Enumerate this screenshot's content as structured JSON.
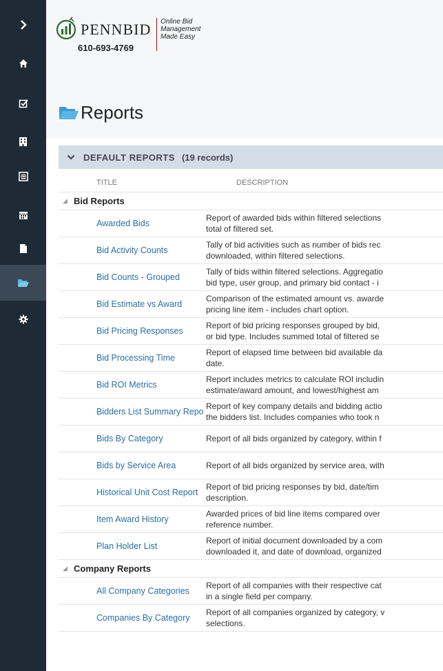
{
  "sidebar": {
    "items": [
      {
        "icon": "chevron-right-icon"
      },
      {
        "icon": "home-icon"
      },
      {
        "icon": "checkbox-icon"
      },
      {
        "icon": "building-icon"
      },
      {
        "icon": "list-icon"
      },
      {
        "icon": "calendar-icon"
      },
      {
        "icon": "document-icon"
      },
      {
        "icon": "folder-open-icon",
        "active": true
      },
      {
        "icon": "gear-icon"
      }
    ],
    "bg_color": "#1e2a35",
    "active_color": "#3b4956"
  },
  "brand": {
    "name": "PENNBID",
    "phone": "610-693-4769",
    "tagline": "Online Bid\nManagement\nMade Easy"
  },
  "page": {
    "title": "Reports"
  },
  "section": {
    "title": "DEFAULT REPORTS",
    "count": "(19 records)"
  },
  "columns": {
    "title": "TITLE",
    "description": "DESCRIPTION"
  },
  "groups": [
    {
      "label": "Bid Reports",
      "rows": [
        {
          "title": "Awarded Bids",
          "description": "Report of awarded bids within filtered selections\ntotal of filtered set."
        },
        {
          "title": "Bid Activity Counts",
          "description": "Tally of bid activities such as number of bids rec\ndownloaded, within filtered selections."
        },
        {
          "title": "Bid Counts - Grouped",
          "description": "Tally of bids within filtered selections. Aggregatio\nbid type, user group, and primary bid contact - i"
        },
        {
          "title": "Bid Estimate vs Award",
          "description": "Comparison of the estimated amount vs. awarde\npricing line item - includes chart option."
        },
        {
          "title": "Bid Pricing Responses",
          "description": "Report of bid pricing responses grouped by bid,\nor bid type. Includes summed total of filtered se"
        },
        {
          "title": "Bid Processing Time",
          "description": "Report of elapsed time between bid available da\ndate."
        },
        {
          "title": "Bid ROI Metrics",
          "description": "Report includes metrics to calculate ROI includin\nestimate/award amount, and lowest/highest am"
        },
        {
          "title": "Bidders List Summary Report",
          "description": "Report of key company details and bidding actio\nthe bidders list. Includes companies who took n"
        },
        {
          "title": "Bids By Category",
          "description": "Report of all bids organized by category, within f"
        },
        {
          "title": "Bids by Service Area",
          "description": "Report of all bids organized by service area, with"
        },
        {
          "title": "Historical Unit Cost Report",
          "description": "Report of bid pricing responses by bid, date/tim\ndescription."
        },
        {
          "title": "Item Award History",
          "description": "Awarded prices of bid line items compared over\nreference number."
        },
        {
          "title": "Plan Holder List",
          "description": "Report of initial document downloaded by a com\ndownloaded it, and date of download, organized"
        }
      ]
    },
    {
      "label": "Company Reports",
      "rows": [
        {
          "title": "All Company Categories",
          "description": "Report of all companies with their respective cat\nin a single field per company."
        },
        {
          "title": "Companies By Category",
          "description": "Report of all companies organized by category, v\nselections."
        }
      ]
    }
  ],
  "colors": {
    "link": "#2d6ea3",
    "section_header": "#d4dde6",
    "folder": "#5ab4e5"
  }
}
